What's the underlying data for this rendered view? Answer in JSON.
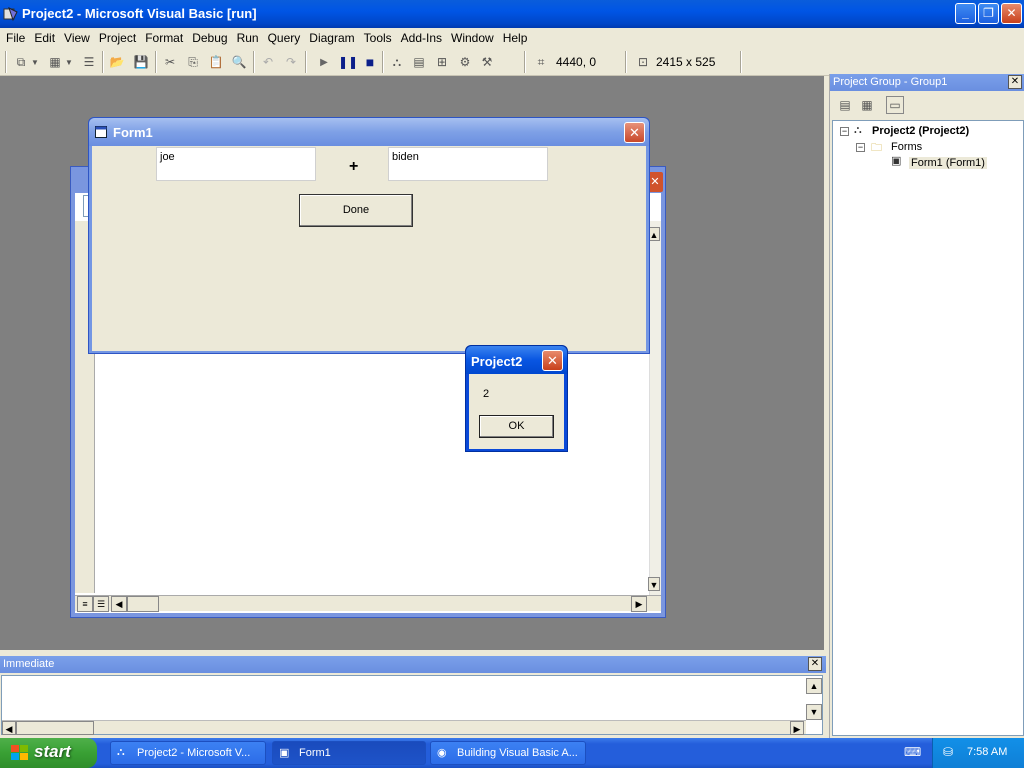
{
  "main_window": {
    "title": "Project2 - Microsoft Visual Basic [run]",
    "controls": {
      "minimize": "_",
      "restore": "❐",
      "close": "✕"
    }
  },
  "menu": [
    "File",
    "Edit",
    "View",
    "Project",
    "Format",
    "Debug",
    "Run",
    "Query",
    "Diagram",
    "Tools",
    "Add-Ins",
    "Window",
    "Help"
  ],
  "toolbar": {
    "position_readout": "4440, 0",
    "size_readout": "2415 x 525"
  },
  "form1": {
    "title": "Form1",
    "close": "✕",
    "textbox_left": "joe",
    "operator_label": "+",
    "textbox_right": "biden",
    "done_button": "Done"
  },
  "msgbox": {
    "title": "Project2",
    "close": "✕",
    "message": "2",
    "ok_button": "OK"
  },
  "project_explorer": {
    "title": "Project Group - Group1",
    "close": "✕",
    "tree": {
      "project": "Project2 (Project2)",
      "folder": "Forms",
      "form": "Form1 (Form1)"
    }
  },
  "immediate": {
    "title": "Immediate",
    "close": "✕"
  },
  "taskbar": {
    "start_label": "start",
    "tasks": [
      "Project2 - Microsoft V...",
      "Form1",
      "Building Visual Basic A..."
    ],
    "clock": "7:58 AM"
  }
}
